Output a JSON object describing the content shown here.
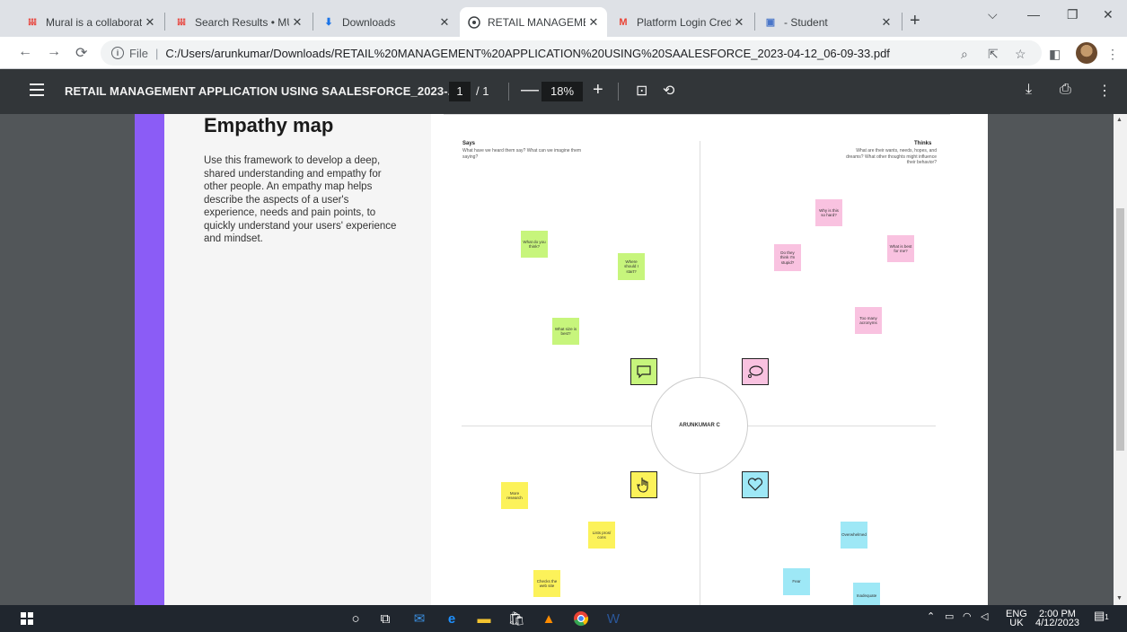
{
  "browser": {
    "tabs": [
      {
        "title": "Mural is a collaborat",
        "icon": "mural-icon",
        "active": false
      },
      {
        "title": "Search Results • MUR",
        "icon": "mural-icon",
        "active": false
      },
      {
        "title": "Downloads",
        "icon": "download-icon",
        "active": false
      },
      {
        "title": "RETAIL MANAGEMEN",
        "icon": "globe-icon",
        "active": true
      },
      {
        "title": "Platform Login Crede",
        "icon": "gmail-icon",
        "active": false
      },
      {
        "title": "- Student",
        "icon": "doc-icon",
        "active": false
      }
    ],
    "url_scheme": "File",
    "url": "C:/Users/arunkumar/Downloads/RETAIL%20MANAGEMENT%20APPLICATION%20USING%20SAALESFORCE_2023-04-12_06-09-33.pdf"
  },
  "pdf_toolbar": {
    "title": "RETAIL MANAGEMENT APPLICATION USING SAALESFORCE_2023-...",
    "page_current": "1",
    "page_total": "/ 1",
    "zoom": "18%"
  },
  "page": {
    "heading": "Empathy map",
    "description": "Use this framework to develop a deep, shared understanding and empathy for other people. An empathy map helps describe the aspects of a user's experience, needs and pain points, to quickly understand your users' experience and mindset.",
    "says": {
      "label": "Says",
      "sub": "What have we heard them say? What can we imagine them saying?",
      "notes": [
        "What do you think?",
        "Where should I start?",
        "What size is best?"
      ]
    },
    "thinks": {
      "label": "Thinks",
      "sub": "What are their wants, needs, hopes, and dreams? What other thoughts might influence their behavior?",
      "notes": [
        "Why is this so hard?",
        "Do they think I'm stupid?",
        "What is best for me?",
        "Too many acronyms"
      ]
    },
    "does": {
      "notes": [
        "More research",
        "Lists pros/ cons",
        "Checks the web site"
      ]
    },
    "feels": {
      "notes": [
        "Overwhelmed",
        "Fear",
        "Inadequate"
      ]
    },
    "persona": "ARUNKUMAR C"
  },
  "taskbar": {
    "lang": "ENG",
    "region": "UK",
    "time": "2:00 PM",
    "date": "4/12/2023",
    "notifications": "1"
  }
}
